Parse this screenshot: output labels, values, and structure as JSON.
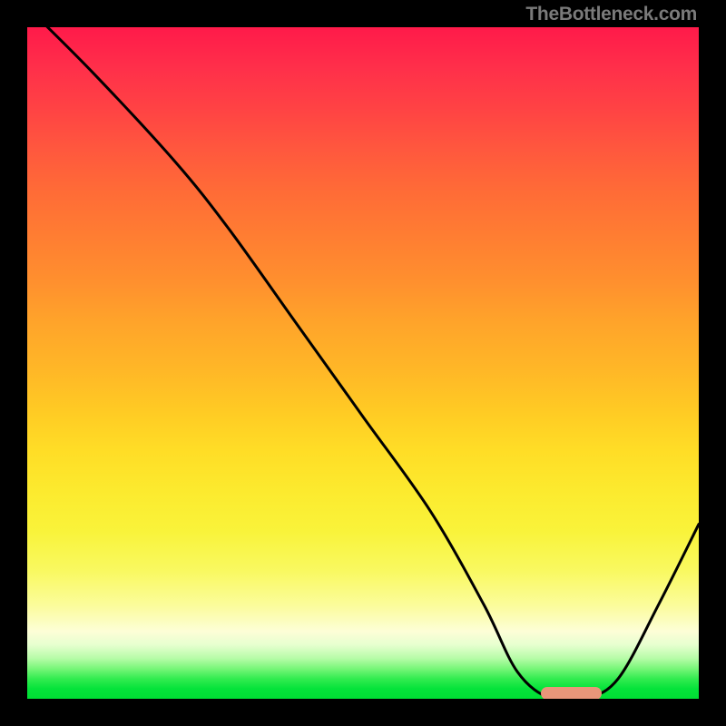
{
  "watermark": "TheBottleneck.com",
  "colors": {
    "background": "#000000",
    "marker": "#e9967a",
    "curve": "#000000"
  },
  "chart_data": {
    "type": "line",
    "title": "",
    "xlabel": "",
    "ylabel": "",
    "xlim": [
      0,
      1
    ],
    "ylim": [
      0,
      1
    ],
    "series": [
      {
        "name": "bottleneck-curve",
        "x": [
          0.0,
          0.1,
          0.22,
          0.3,
          0.4,
          0.5,
          0.6,
          0.68,
          0.73,
          0.78,
          0.83,
          0.88,
          0.94,
          1.0
        ],
        "y": [
          1.03,
          0.93,
          0.8,
          0.7,
          0.56,
          0.42,
          0.28,
          0.14,
          0.04,
          0.0,
          0.0,
          0.03,
          0.14,
          0.26
        ]
      }
    ],
    "marker": {
      "x0": 0.765,
      "x1": 0.855,
      "y": 0.005
    },
    "gradient_note": "red (high) → yellow → green (low)"
  }
}
